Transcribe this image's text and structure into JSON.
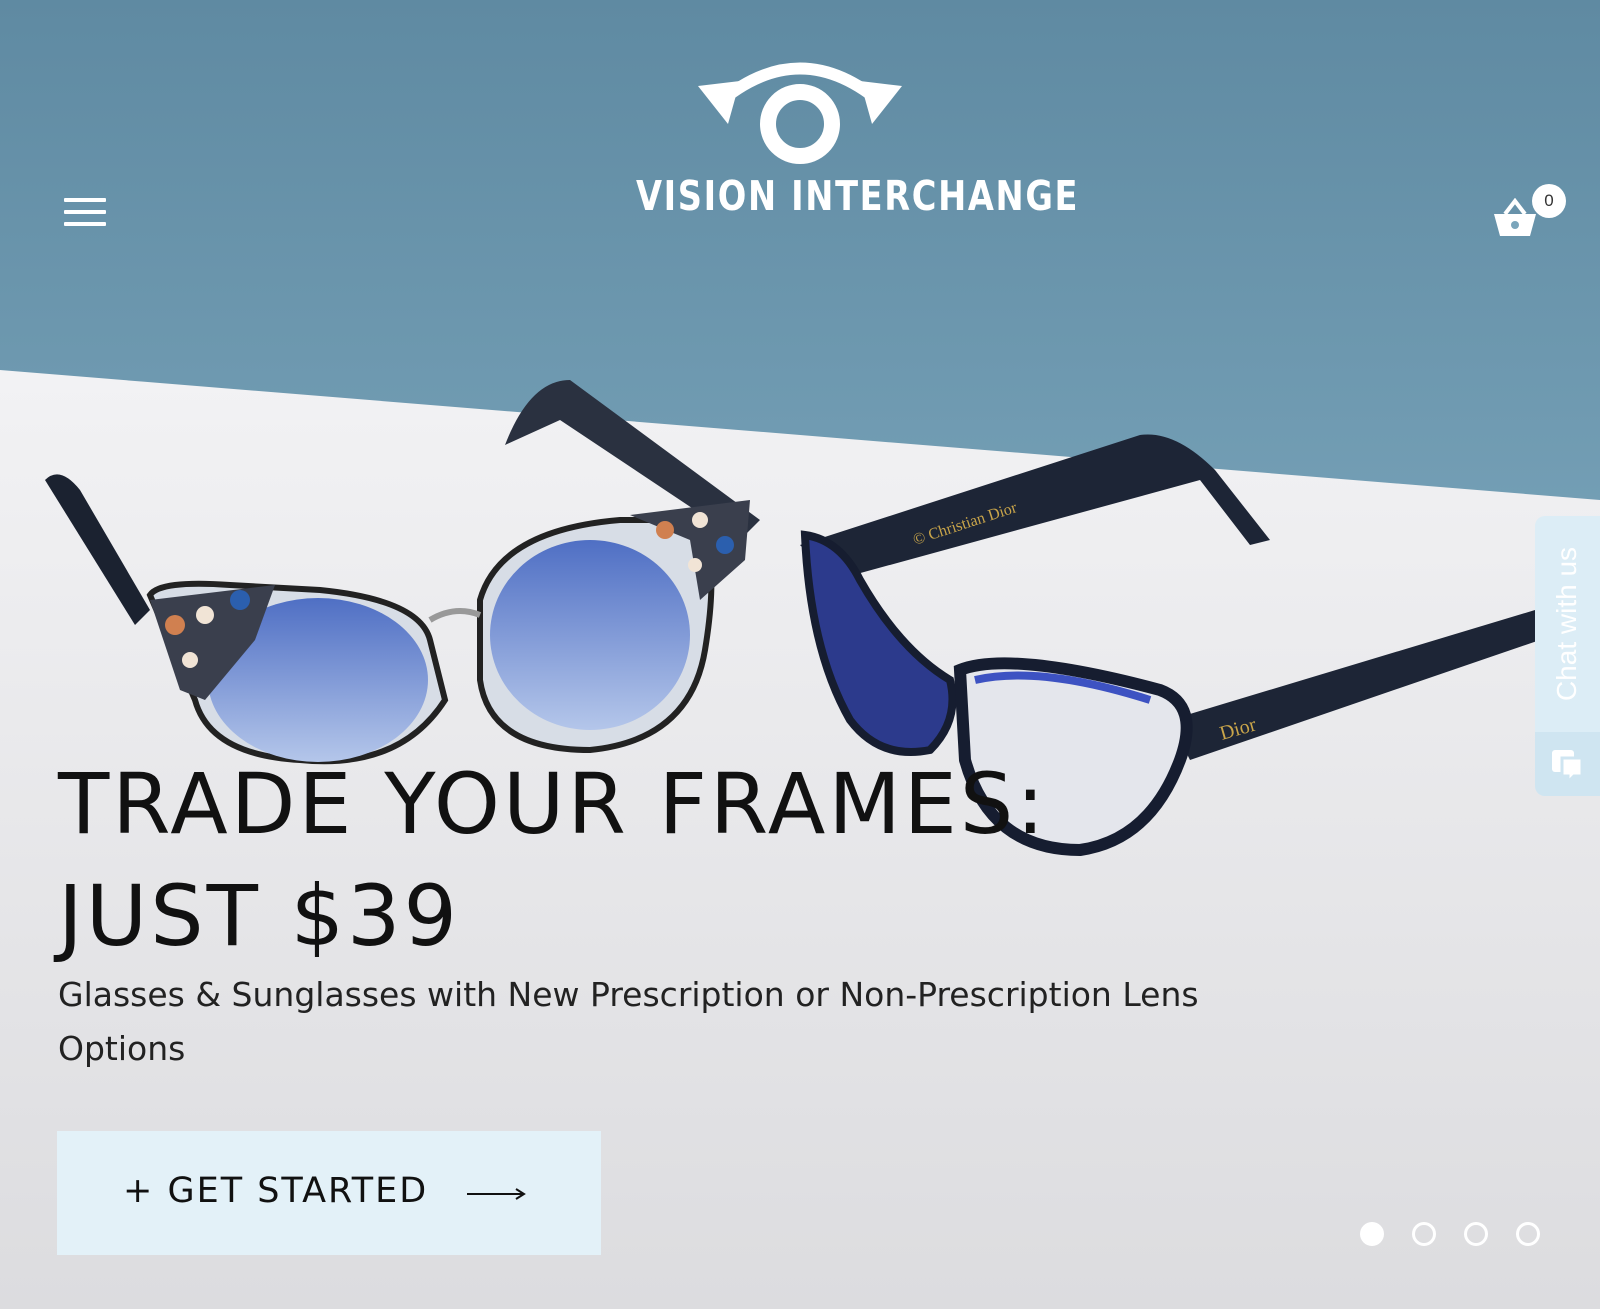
{
  "brand": {
    "name": "VISION INTERCHANGE"
  },
  "header": {
    "menu_icon": "hamburger-menu-icon",
    "cart_icon": "shopping-basket-icon",
    "cart_count": "0"
  },
  "hero": {
    "headline_line1": "TRADE YOUR FRAMES:",
    "headline_line2": "JUST $39",
    "subheading": "Glasses & Sunglasses with New Prescription or Non-Prescription Lens Options",
    "cta_label": "+ GET STARTED",
    "cta_icon": "long-arrow-right-icon",
    "frame_brand_left_temple": "© Christian Dior",
    "frame_brand_right_temple": "Dior",
    "slides": [
      {
        "active": true
      },
      {
        "active": false
      },
      {
        "active": false
      },
      {
        "active": false
      }
    ]
  },
  "chat": {
    "label": "Chat with us",
    "icon": "chat-bubble-icon"
  },
  "colors": {
    "wall": "#6f9bb2",
    "table": "#e7e7ea",
    "text_dark": "#111111",
    "cta_bg": "#e3f1f8",
    "chat_bg": "#dcedf6",
    "lens_blue": "#6a8bd6",
    "frame_navy": "#1d2536"
  }
}
